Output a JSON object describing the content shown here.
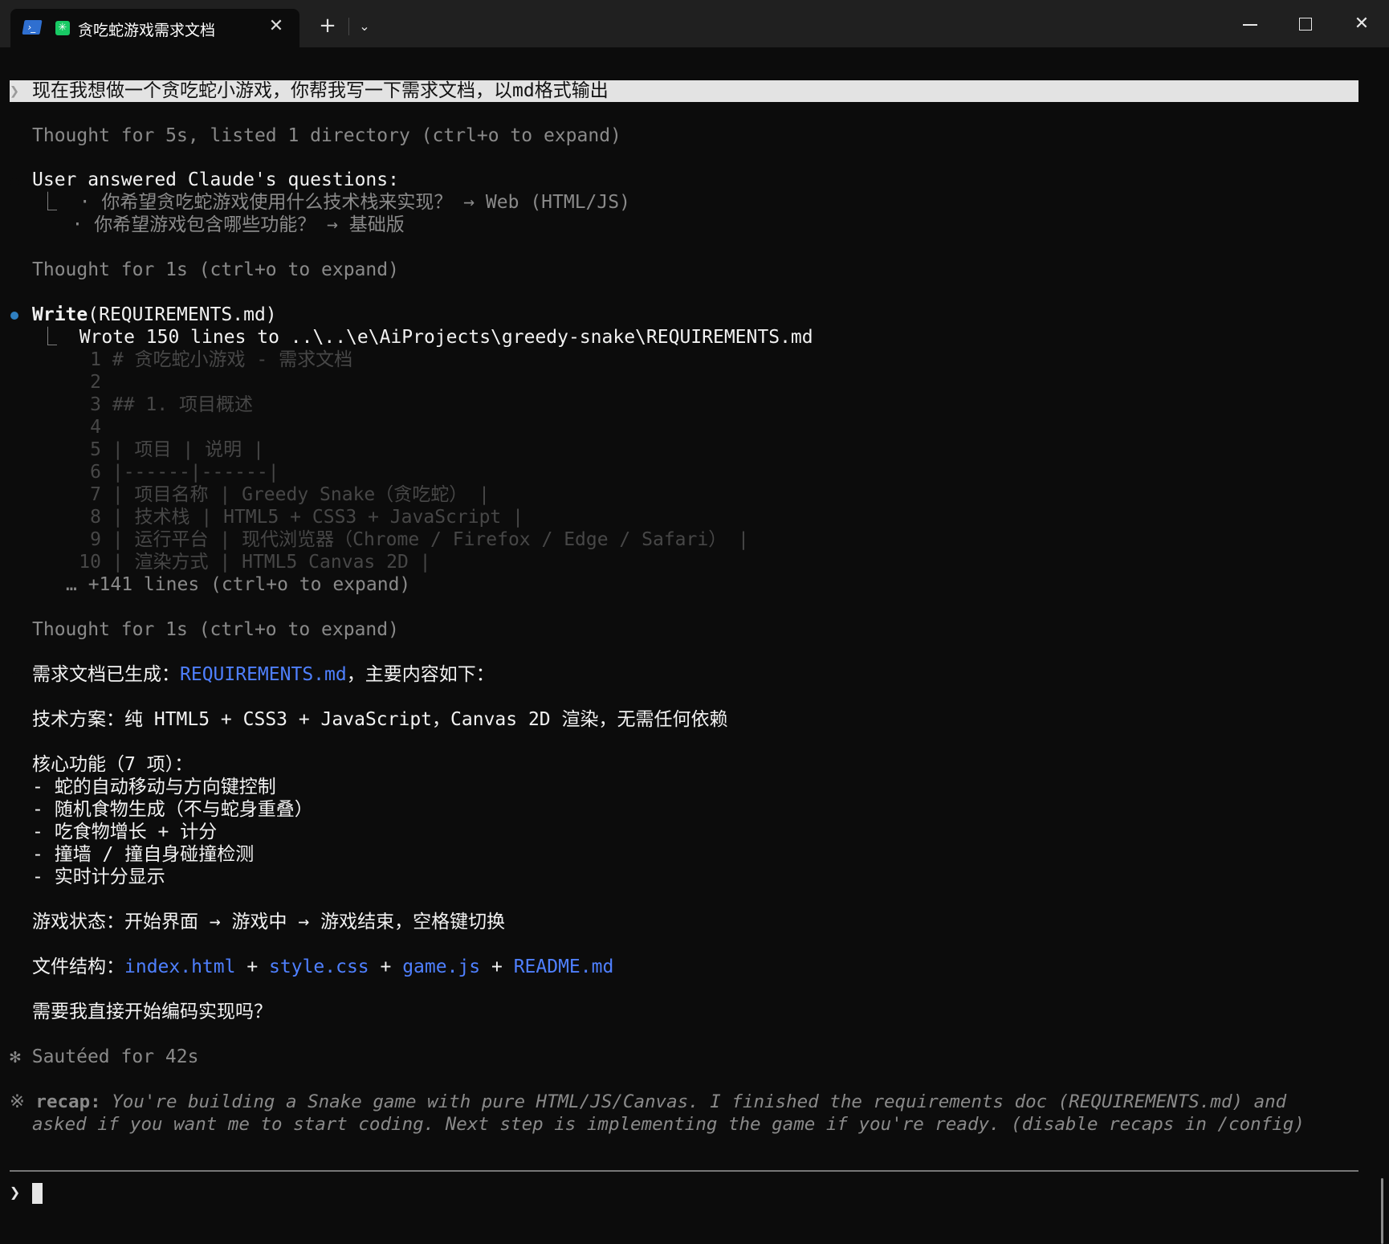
{
  "window": {
    "tab_title": "贪吃蛇游戏需求文档",
    "tab_close": "✕",
    "new_tab": "+",
    "dropdown": "⌄",
    "maximize": "",
    "close": "✕"
  },
  "prompt": {
    "chevron": "❯",
    "text": "现在我想做一个贪吃蛇小游戏，你帮我写一下需求文档，以md格式输出"
  },
  "transcript": {
    "thought1": "Thought for 5s, listed 1 directory (ctrl+o to expand)",
    "questions_header": "User answered Claude's questions:",
    "question1_prefix": "⎿  · ",
    "question1": "你希望贪吃蛇游戏使用什么技术栈来实现？ → Web (HTML/JS)",
    "question2_prefix": "   · ",
    "question2": "你希望游戏包含哪些功能？ → 基础版",
    "thought2": "Thought for 1s (ctrl+o to expand)",
    "write_tool": "Write",
    "write_arg": "(REQUIREMENTS.md)",
    "write_result_prefix": "⎿  ",
    "write_result": "Wrote 150 lines to ..\\..\\e\\AiProjects\\greedy-snake\\REQUIREMENTS.md",
    "file_preview": [
      {
        "num": "1",
        "text": "# 贪吃蛇小游戏 - 需求文档"
      },
      {
        "num": "2",
        "text": ""
      },
      {
        "num": "3",
        "text": "## 1. 项目概述"
      },
      {
        "num": "4",
        "text": ""
      },
      {
        "num": "5",
        "text": "| 项目 | 说明 |"
      },
      {
        "num": "6",
        "text": "|------|------|"
      },
      {
        "num": "7",
        "text": "| 项目名称 | Greedy Snake（贪吃蛇） |"
      },
      {
        "num": "8",
        "text": "| 技术栈 | HTML5 + CSS3 + JavaScript |"
      },
      {
        "num": "9",
        "text": "| 运行平台 | 现代浏览器（Chrome / Firefox / Edge / Safari） |"
      },
      {
        "num": "10",
        "text": "| 渲染方式 | HTML5 Canvas 2D |"
      }
    ],
    "more_lines": "… +141 lines (ctrl+o to expand)",
    "thought3": "Thought for 1s (ctrl+o to expand)",
    "summary_intro_a": "需求文档已生成：",
    "summary_intro_link": "REQUIREMENTS.md",
    "summary_intro_b": "，主要内容如下：",
    "tech_plan": "技术方案：纯 HTML5 + CSS3 + JavaScript，Canvas 2D 渲染，无需任何依赖",
    "core_features_title": "核心功能（7 项）：",
    "core_features": [
      "- 蛇的自动移动与方向键控制",
      "- 随机食物生成（不与蛇身重叠）",
      "- 吃食物增长 + 计分",
      "- 撞墙 / 撞自身碰撞检测",
      "- 实时计分显示"
    ],
    "game_states": "游戏状态：开始界面 → 游戏中 → 游戏结束，空格键切换",
    "file_structure_label": "文件结构：",
    "file_structure_files": [
      "index.html",
      "style.css",
      "game.js",
      "README.md"
    ],
    "file_structure_plus": " + ",
    "question": "需要我直接开始编码实现吗？",
    "sauteed_icon": "✻",
    "sauteed": "Sautéed for 42s",
    "recap_icon": "※",
    "recap_label": "recap:",
    "recap_line1": " You're building a Snake game with pure HTML/JS/Canvas. I finished the requirements doc (REQUIREMENTS.md) and",
    "recap_line2": "asked if you want me to start coding. Next step is implementing the game if you're ready. (disable recaps in /config)"
  },
  "input": {
    "chevron": "❯",
    "value": ""
  },
  "colors": {
    "background": "#0c0c0c",
    "link": "#4f80ff",
    "tool_dot": "#2f7fc0",
    "dim_text": "#8a8a8a",
    "prompt_highlight": "#e3e3e3"
  }
}
